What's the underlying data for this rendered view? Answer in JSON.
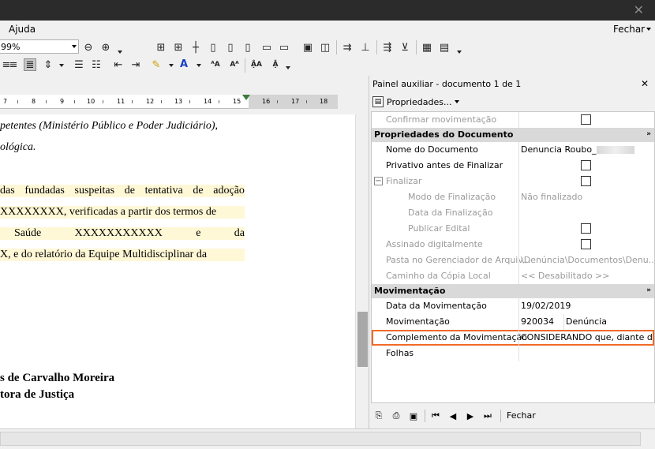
{
  "menu": {
    "ajuda": "Ajuda",
    "fechar": "Fechar"
  },
  "toolbar": {
    "zoom_value": "99%"
  },
  "ruler": {
    "numbers": [
      "7",
      "8",
      "9",
      "10",
      "11",
      "12",
      "13",
      "14",
      "15",
      "16",
      "17",
      "18"
    ]
  },
  "document": {
    "lines": [
      {
        "text": "petentes (Ministério Público e Poder Judiciário),",
        "style": "it"
      },
      {
        "text": "ológica.",
        "style": "it"
      },
      {
        "words": [
          "das",
          "fundadas",
          "suspeitas",
          "de",
          "tentativa",
          "de",
          "adoção"
        ],
        "style": "hl"
      },
      {
        "text": "XXXXXXXX, verificadas a partir dos termos de",
        "style": "hl"
      },
      {
        "words": [
          "Saúde",
          "XXXXXXXXXXX",
          "e",
          "da"
        ],
        "style": "hl"
      },
      {
        "text": "X, e do relatório da Equipe Multidisciplinar da",
        "style": "hl"
      }
    ],
    "signature_name": "s de Carvalho Moreira",
    "signature_title": "tora de Justiça"
  },
  "panel": {
    "title": "Painel auxiliar - documento 1 de 1",
    "properties_button": "Propriedades...",
    "rows": {
      "confirmar": "Confirmar movimentação",
      "sec_props": "Propriedades do Documento",
      "nome": "Nome do Documento",
      "nome_val": "Denuncia Roubo_",
      "privativo": "Privativo antes de Finalizar",
      "finalizar": "Finalizar",
      "modo": "Modo de Finalização",
      "modo_val": "Não finalizado",
      "data_fin": "Data da Finalização",
      "publicar": "Publicar Edital",
      "assinado": "Assinado digitalmente",
      "pasta": "Pasta no Gerenciador de Arquiv...",
      "pasta_val": "\\Denúncia\\Documentos\\Denu...",
      "caminho": "Caminho da Cópia Local",
      "caminho_val": "<< Desabilitado >>",
      "sec_mov": "Movimentação",
      "data_mov": "Data da Movimentação",
      "data_mov_val": "19/02/2019",
      "mov": "Movimentação",
      "mov_code": "920034",
      "mov_name": "Denúncia",
      "complemento": "Complemento da Movimentação",
      "complemento_val": "CONSIDERANDO que, diante d...",
      "folhas": "Folhas"
    },
    "bottom_fechar": "Fechar"
  },
  "colors": {
    "highlight_outline": "#f06a28",
    "text_highlight": "#fff8d6",
    "section_header": "#d9d9d9"
  }
}
